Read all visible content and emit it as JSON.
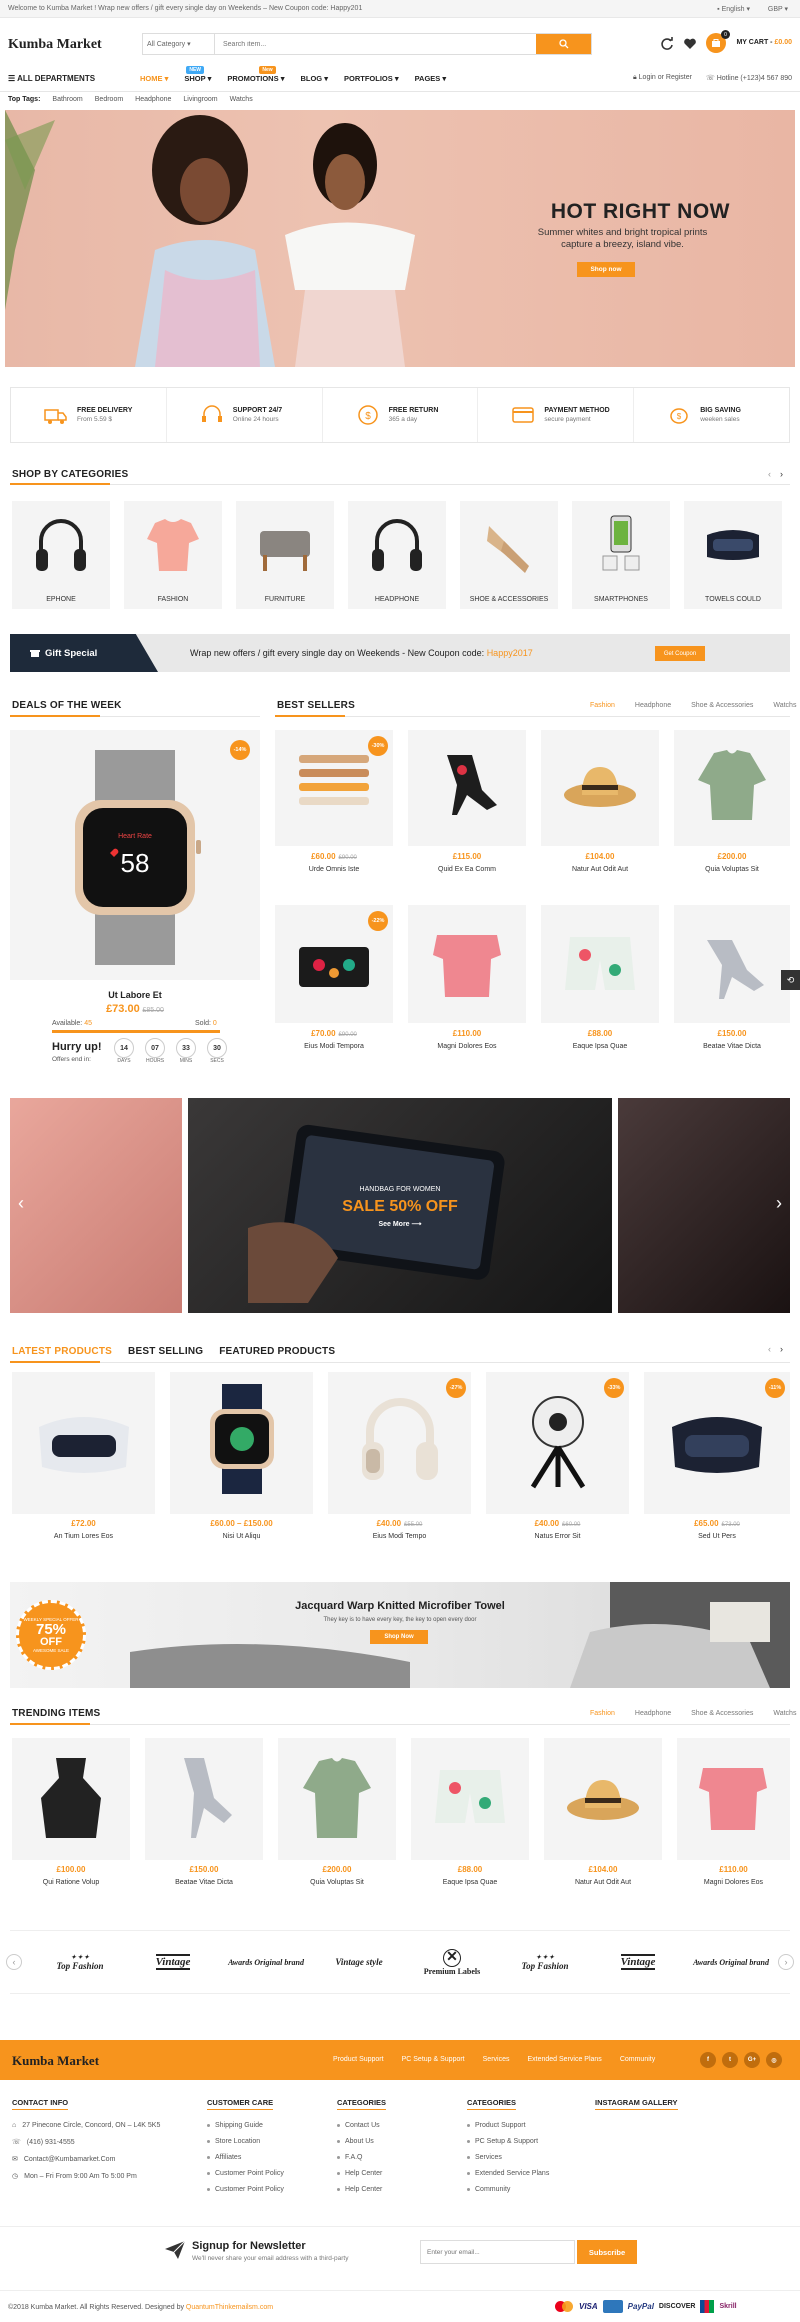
{
  "topbar": {
    "welcome": "Welcome to Kumba Market ! Wrap new offers / gift every single day on Weekends – New Coupon code: Happy201",
    "language": "English",
    "currency": "GBP"
  },
  "header": {
    "logo": "Kumba Market",
    "search_category": "All Category",
    "search_placeholder": "Search item...",
    "cart_label": "MY CART -",
    "cart_total": "£0.00",
    "cart_count": "0"
  },
  "nav": {
    "departments": "ALL DEPARTMENTS",
    "items": [
      {
        "label": "HOME",
        "badge": ""
      },
      {
        "label": "SHOP",
        "badge": "NEW"
      },
      {
        "label": "PROMOTIONS",
        "badge": "New"
      },
      {
        "label": "BLOG",
        "badge": ""
      },
      {
        "label": "PORTFOLIOS",
        "badge": ""
      },
      {
        "label": "PAGES",
        "badge": ""
      }
    ],
    "login": "Login or Register",
    "hotline": "Hotline (+123)4 567 890"
  },
  "top_tags": {
    "label": "Top Tags:",
    "tags": [
      "Bathroom",
      "Bedroom",
      "Headphone",
      "Livingroom",
      "Watchs"
    ]
  },
  "hero": {
    "title": "HOT RIGHT NOW",
    "subtitle": "Summer whites and bright tropical prints capture a breezy, island vibe.",
    "button": "Shop now"
  },
  "features": [
    {
      "title": "FREE DELIVERY",
      "sub": "From 5.59 $",
      "icon": "truck-icon"
    },
    {
      "title": "SUPPORT 24/7",
      "sub": "Online 24 hours",
      "icon": "headset-icon"
    },
    {
      "title": "FREE RETURN",
      "sub": "365 a day",
      "icon": "return-icon"
    },
    {
      "title": "PAYMENT METHOD",
      "sub": "secure payment",
      "icon": "card-icon"
    },
    {
      "title": "BIG SAVING",
      "sub": "weeken sales",
      "icon": "piggy-icon"
    }
  ],
  "categories": {
    "title": "SHOP BY CATEGORIES",
    "items": [
      "EPHONE",
      "FASHION",
      "FURNITURE",
      "HEADPHONE",
      "SHOE & ACCESSORIES",
      "SMARTPHONES",
      "TOWELS COULD"
    ]
  },
  "gift": {
    "label": "Gift Special",
    "text": "Wrap new offers / gift every single day on Weekends - New Coupon code:",
    "code": "Happy2017",
    "button": "Get Coupon"
  },
  "deals": {
    "title": "DEALS OF THE WEEK",
    "badge": "-14%",
    "product": "Ut Labore Et",
    "price": "£73.00",
    "old_price": "£85.00",
    "available_label": "Available:",
    "available": "45",
    "sold_label": "Sold:",
    "sold": "0",
    "hurry": "Hurry up!",
    "offers_end": "Offers end in:",
    "countdown": [
      {
        "value": "14",
        "unit": "DAYS"
      },
      {
        "value": "07",
        "unit": "HOURS"
      },
      {
        "value": "33",
        "unit": "MINS"
      },
      {
        "value": "30",
        "unit": "SECS"
      }
    ],
    "watch_time": "58",
    "watch_text": "Heart Rate"
  },
  "best_sellers": {
    "title": "BEST SELLERS",
    "tabs": [
      "Fashion",
      "Headphone",
      "Shoe & Accessories",
      "Watchs"
    ],
    "products": [
      {
        "name": "Urde Omnis Iste",
        "price": "£60.00",
        "old": "£90.00",
        "badge": "-30%"
      },
      {
        "name": "Quid Ex Ea Comm",
        "price": "£115.00",
        "old": "",
        "badge": ""
      },
      {
        "name": "Natur Aut Odit Aut",
        "price": "£104.00",
        "old": "",
        "badge": ""
      },
      {
        "name": "Quia Voluptas Sit",
        "price": "£200.00",
        "old": "",
        "badge": ""
      },
      {
        "name": "Eius Modi Tempora",
        "price": "£70.00",
        "old": "£90.00",
        "badge": "-22%"
      },
      {
        "name": "Magni Dolores Eos",
        "price": "£110.00",
        "old": "",
        "badge": ""
      },
      {
        "name": "Eaque Ipsa Quae",
        "price": "£88.00",
        "old": "",
        "badge": ""
      },
      {
        "name": "Beatae Vitae Dicta",
        "price": "£150.00",
        "old": "",
        "badge": ""
      }
    ]
  },
  "slider": {
    "kicker": "HANDBAG FOR WOMEN",
    "headline": "SALE 50% OFF",
    "link": "See More"
  },
  "latest": {
    "tabs": [
      "LATEST PRODUCTS",
      "BEST SELLING",
      "FEATURED PRODUCTS"
    ],
    "products": [
      {
        "name": "An Tium Lores Eos",
        "price": "£72.00",
        "old": "",
        "badge": ""
      },
      {
        "name": "Nisi Ut Aliqu",
        "price": "£60.00 – £150.00",
        "old": "",
        "badge": ""
      },
      {
        "name": "Eius Modi Tempo",
        "price": "£40.00",
        "old": "£55.00",
        "badge": "-27%"
      },
      {
        "name": "Natus Error Sit",
        "price": "£40.00",
        "old": "£60.00",
        "badge": "-33%"
      },
      {
        "name": "Sed Ut Pers",
        "price": "£65.00",
        "old": "£73.00",
        "badge": "-11%"
      }
    ]
  },
  "banner": {
    "title": "Jacquard Warp Knitted Microfiber Towel",
    "sub": "They key is to have every key, the key to open every door",
    "button": "Shop Now",
    "seal_top": "WEEKLY SPECIAL OFFER",
    "seal_value": "75%",
    "seal_off": "OFF",
    "seal_bottom": "AWESOME SALE"
  },
  "trending": {
    "title": "TRENDING ITEMS",
    "tabs": [
      "Fashion",
      "Headphone",
      "Shoe & Accessories",
      "Watchs"
    ],
    "products": [
      {
        "name": "Qui Ratione Volup",
        "price": "£100.00"
      },
      {
        "name": "Beatae Vitae Dicta",
        "price": "£150.00"
      },
      {
        "name": "Quia Voluptas Sit",
        "price": "£200.00"
      },
      {
        "name": "Eaque Ipsa Quae",
        "price": "£88.00"
      },
      {
        "name": "Natur Aut Odit Aut",
        "price": "£104.00"
      },
      {
        "name": "Magni Dolores Eos",
        "price": "£110.00"
      }
    ]
  },
  "brands": [
    "Top Fashion",
    "Vintage",
    "Awards Original brand",
    "Vintage style",
    "Premium Labels",
    "Top Fashion",
    "Vintage",
    "Awards Original brand"
  ],
  "footer": {
    "logo": "Kumba Market",
    "links": [
      "Product Support",
      "PC Setup & Support",
      "Services",
      "Extended Service Plans",
      "Community"
    ],
    "social": [
      "f",
      "t",
      "G+",
      "◎"
    ],
    "contact": {
      "title": "CONTACT INFO",
      "address": "27 Pinecone Circle, Concord, ON – L4K 5K5",
      "phone": "(416) 931-4555",
      "email": "Contact@Kumbamarket.Com",
      "hours": "Mon – Fri From 9:00 Am To 5:00 Pm"
    },
    "columns": [
      {
        "title": "CUSTOMER CARE",
        "items": [
          "Shipping Guide",
          "Store Location",
          "Affiliates",
          "Customer Point Policy",
          "Customer Point Policy"
        ]
      },
      {
        "title": "CATEGORIES",
        "items": [
          "Contact Us",
          "About Us",
          "F.A.Q",
          "Help Center",
          "Help Center"
        ]
      },
      {
        "title": "CATEGORIES",
        "items": [
          "Product Support",
          "PC Setup & Support",
          "Services",
          "Extended Service Plans",
          "Community"
        ]
      },
      {
        "title": "INSTAGRAM GALLERY",
        "items": []
      }
    ],
    "newsletter_title": "Signup for Newsletter",
    "newsletter_sub": "We'll never share your email address with a third-party",
    "newsletter_placeholder": "Enter your email...",
    "subscribe": "Subscribe",
    "copyright": "©2018 Kumba Market. All Rights Reserved. Designed by",
    "designer": "QuantumThinkemailsm.com",
    "payments": [
      "VISA",
      "PayPal",
      "DISCOVER",
      "Skrill"
    ]
  },
  "colors": {
    "accent": "#f7941d",
    "dark": "#1e2a3a"
  }
}
